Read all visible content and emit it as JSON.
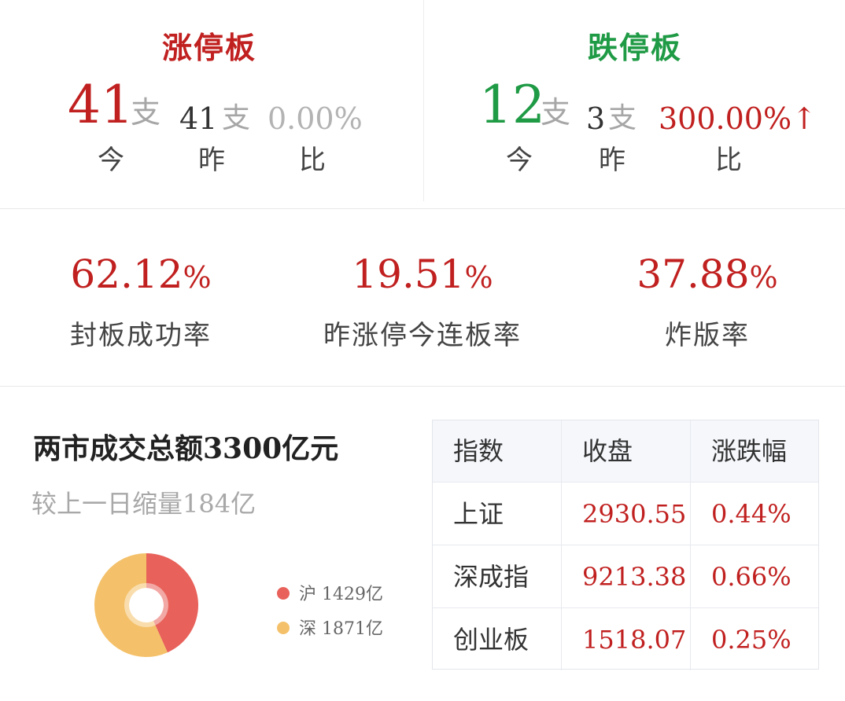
{
  "limit_up": {
    "title": "涨停板",
    "today": "41",
    "yesterday": "41",
    "ratio": "0.00%",
    "unit": "支",
    "label_today": "今",
    "label_yesterday": "昨",
    "label_ratio": "比"
  },
  "limit_down": {
    "title": "跌停板",
    "today": "12",
    "yesterday": "3",
    "ratio": "300.00%↑",
    "unit": "支",
    "label_today": "今",
    "label_yesterday": "昨",
    "label_ratio": "比"
  },
  "stats": [
    {
      "value": "62.12",
      "unit": "%",
      "label": "封板成功率"
    },
    {
      "value": "19.51",
      "unit": "%",
      "label": "昨涨停今连板率"
    },
    {
      "value": "37.88",
      "unit": "%",
      "label": "炸版率"
    }
  ],
  "turnover": {
    "title": "两市成交总额3300亿元",
    "subtitle": "较上一日缩量184亿"
  },
  "chart_data": {
    "type": "pie",
    "categories": [
      "沪",
      "深"
    ],
    "values": [
      1429,
      1871
    ],
    "unit": "亿",
    "labels": [
      "沪 1429亿",
      "深 1871亿"
    ],
    "colors": [
      "#e8615a",
      "#f4c16a"
    ],
    "legend": "right"
  },
  "index_table": {
    "headers": [
      "指数",
      "收盘",
      "涨跌幅"
    ],
    "rows": [
      [
        "上证",
        "2930.55",
        "0.44%"
      ],
      [
        "深成指",
        "9213.38",
        "0.66%"
      ],
      [
        "创业板",
        "1518.07",
        "0.25%"
      ]
    ]
  }
}
